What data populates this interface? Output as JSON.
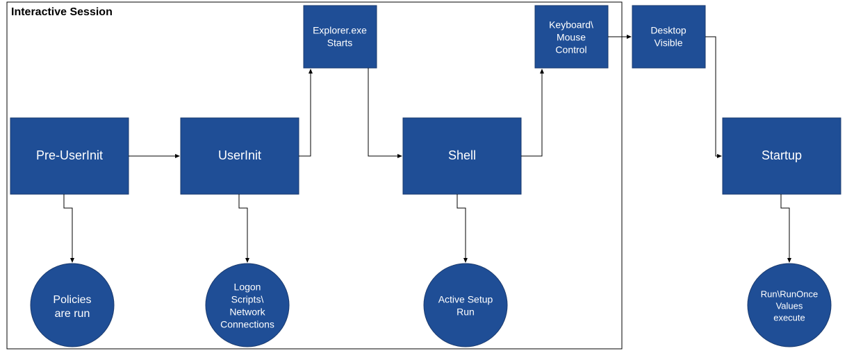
{
  "diagram": {
    "container_title": "Interactive Session",
    "main_boxes": {
      "preuserinit": "Pre-UserInit",
      "userinit": "UserInit",
      "shell": "Shell",
      "startup": "Startup"
    },
    "top_boxes": {
      "explorer": {
        "line1": "Explorer.exe",
        "line2": "Starts"
      },
      "keyboard": {
        "line1": "Keyboard\\",
        "line2": "Mouse",
        "line3": "Control"
      },
      "desktop": {
        "line1": "Desktop",
        "line2": "Visible"
      }
    },
    "circles": {
      "policies": {
        "line1": "Policies",
        "line2": "are run"
      },
      "logon": {
        "line1": "Logon",
        "line2": "Scripts\\",
        "line3": "Network",
        "line4": "Connections"
      },
      "active": {
        "line1": "Active Setup",
        "line2": "Run"
      },
      "runonce": {
        "line1": "Run\\RunOnce",
        "line2": "Values",
        "line3": "execute"
      }
    }
  }
}
